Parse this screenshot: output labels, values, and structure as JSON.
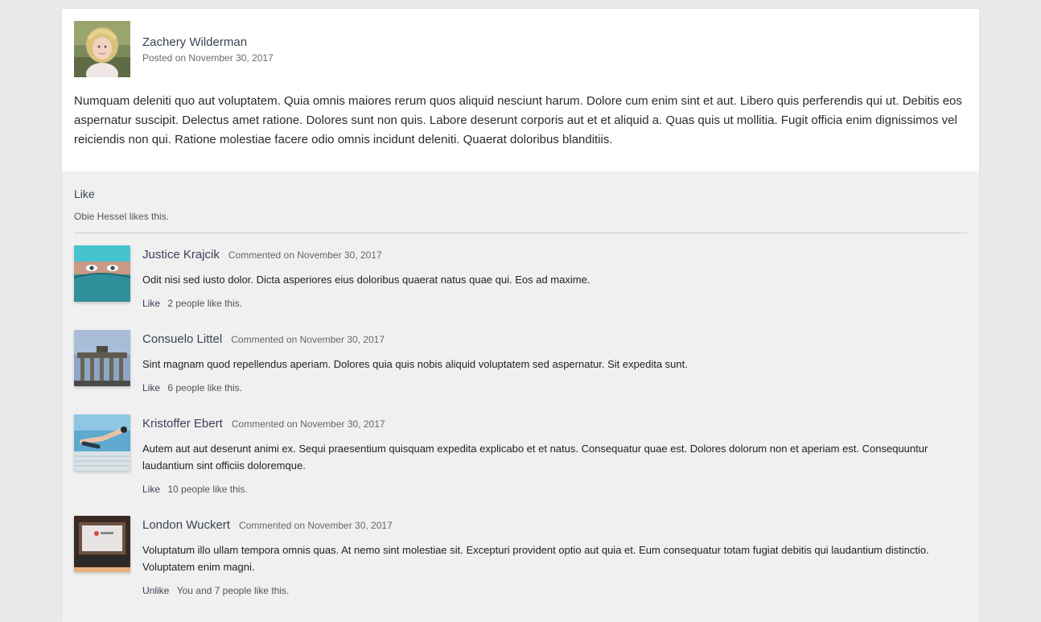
{
  "post": {
    "author": "Zachery Wilderman",
    "date": "Posted on November 30, 2017",
    "body": "Numquam deleniti quo aut voluptatem. Quia omnis maiores rerum quos aliquid nesciunt harum. Dolore cum enim sint et aut. Libero quis perferendis qui ut. Debitis eos aspernatur suscipit. Delectus amet ratione. Dolores sunt non quis. Labore deserunt corporis aut et et aliquid a. Quas quis ut mollitia. Fugit officia enim dignissimos vel reiciendis non qui. Ratione molestiae facere odio omnis incidunt deleniti. Quaerat doloribus blanditiis.",
    "like_label": "Like",
    "likes_text": "Obie Hessel likes this."
  },
  "comments": [
    {
      "author": "Justice Krajcik",
      "date": "Commented on November 30, 2017",
      "text": "Odit nisi sed iusto dolor. Dicta asperiores eius doloribus quaerat natus quae qui. Eos ad maxime.",
      "like_label": "Like",
      "likes_text": "2 people like this.",
      "avatar": "surgeon-mask-photo"
    },
    {
      "author": "Consuelo Littel",
      "date": "Commented on November 30, 2017",
      "text": "Sint magnam quod repellendus aperiam. Dolores quia quis nobis aliquid voluptatem sed aspernatur. Sit expedita sunt.",
      "like_label": "Like",
      "likes_text": "6 people like this.",
      "avatar": "gate-monument-photo"
    },
    {
      "author": "Kristoffer Ebert",
      "date": "Commented on November 30, 2017",
      "text": "Autem aut aut deserunt animi ex. Sequi praesentium quisquam expedita explicabo et et natus. Consequatur quae est. Dolores dolorum non et aperiam est. Consequuntur laudantium sint officiis doloremque.",
      "like_label": "Like",
      "likes_text": "10 people like this.",
      "avatar": "swimmer-diving-photo"
    },
    {
      "author": "London Wuckert",
      "date": "Commented on November 30, 2017",
      "text": "Voluptatum illo ullam tempora omnis quas. At nemo sint molestiae sit. Excepturi provident optio aut quia et. Eum consequatur totam fugiat debitis qui laudantium distinctio. Voluptatem enim magni.",
      "like_label": "Unlike",
      "likes_text": "You and 7 people like this.",
      "avatar": "laptop-screen-photo"
    }
  ]
}
